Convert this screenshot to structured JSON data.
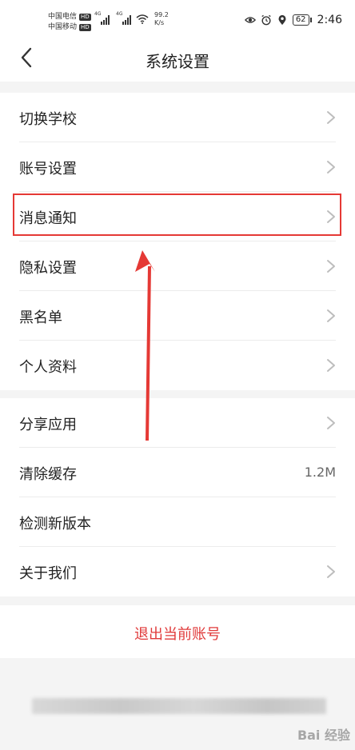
{
  "status_bar": {
    "carrier1": "中国电信",
    "carrier2": "中国移动",
    "hd": "HD",
    "network": "4G",
    "speed_value": "99.2",
    "speed_unit": "K/s",
    "battery": "62",
    "time": "2:46"
  },
  "navbar": {
    "title": "系统设置",
    "back_icon": "chevron-left-icon"
  },
  "settings_group1": [
    {
      "label": "切换学校"
    },
    {
      "label": "账号设置"
    },
    {
      "label": "消息通知"
    },
    {
      "label": "隐私设置"
    },
    {
      "label": "黑名单"
    },
    {
      "label": "个人资料"
    }
  ],
  "settings_group2": [
    {
      "label": "分享应用"
    },
    {
      "label": "清除缓存",
      "value": "1.2M"
    },
    {
      "label": "检测新版本"
    },
    {
      "label": "关于我们"
    }
  ],
  "logout": {
    "label": "退出当前账号"
  },
  "annotation": {
    "highlight_color": "#e53935",
    "arrow_color": "#e53935"
  },
  "watermark": {
    "text": "Bai 经验"
  },
  "colors": {
    "accent_red": "#e03a3a",
    "background": "#f4f4f4"
  }
}
